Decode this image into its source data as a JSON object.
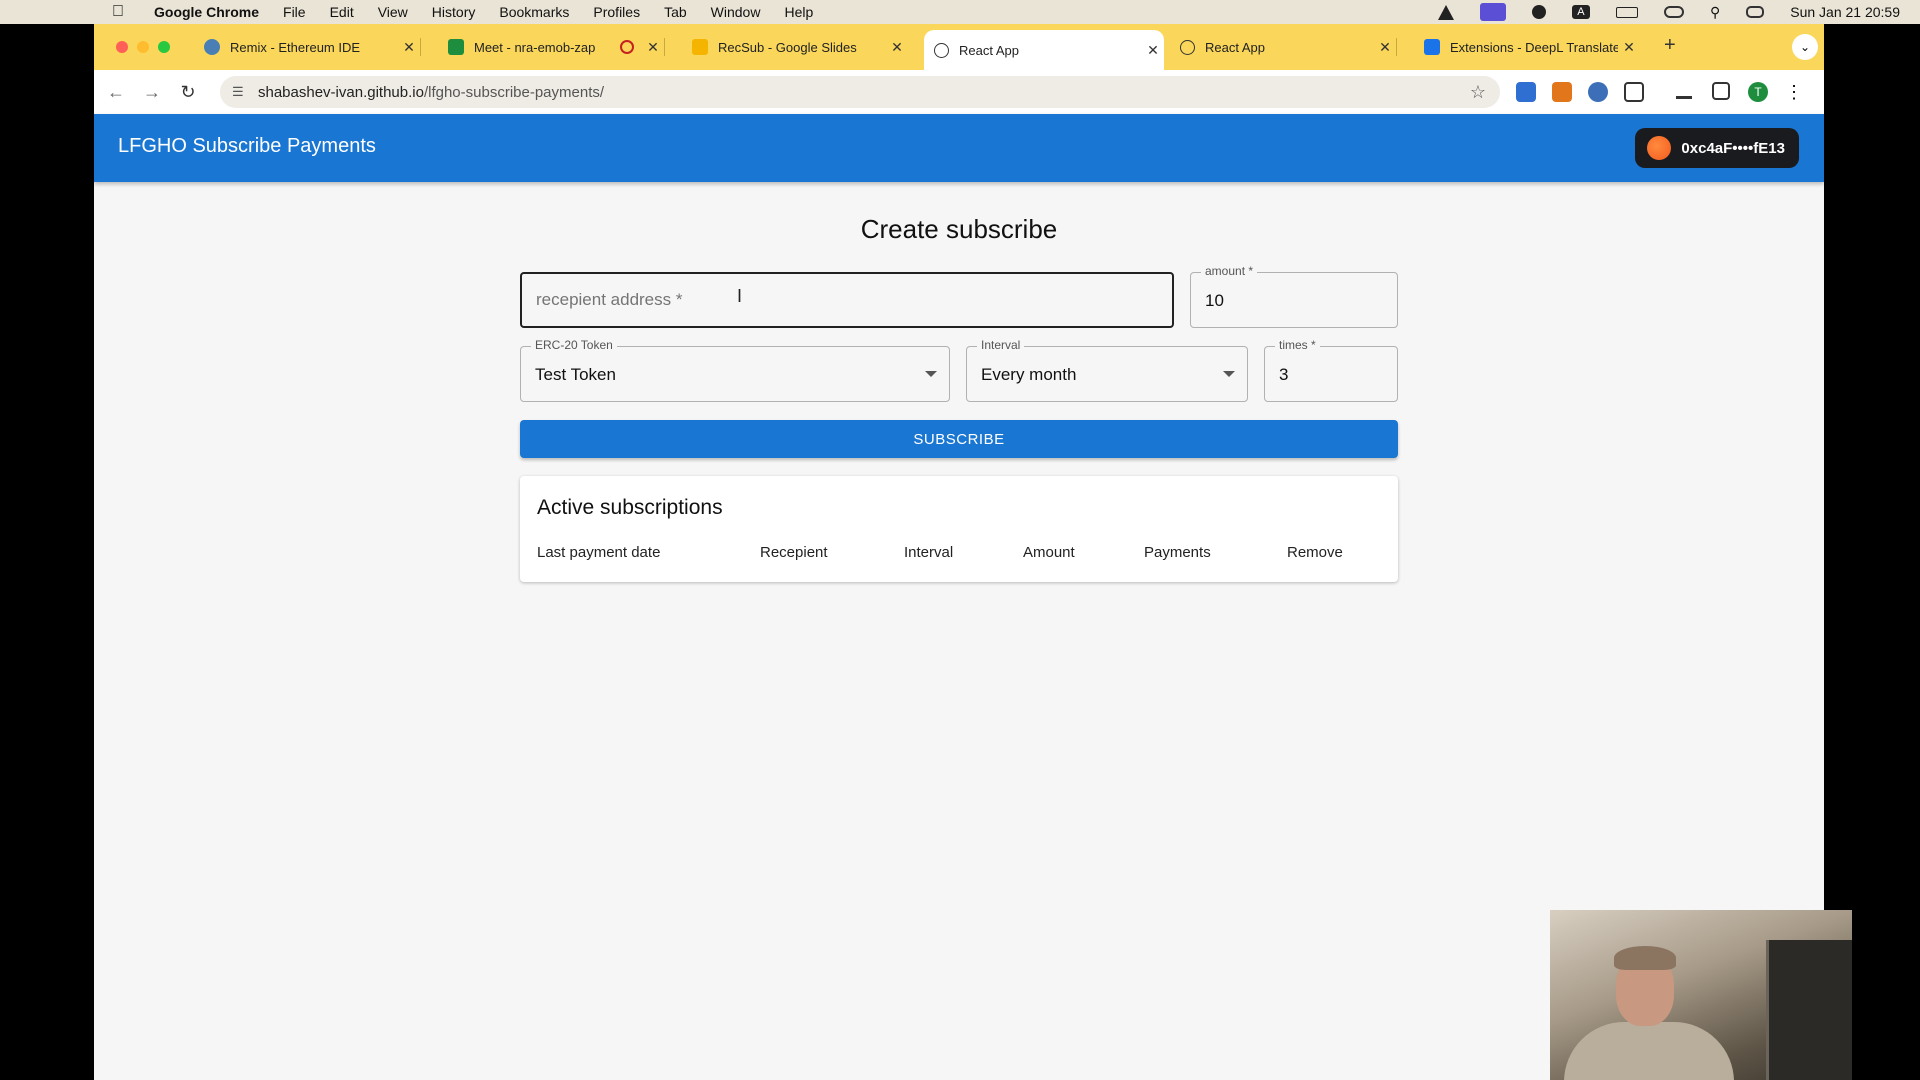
{
  "menubar": {
    "app": "Google Chrome",
    "items": [
      "File",
      "Edit",
      "View",
      "History",
      "Bookmarks",
      "Profiles",
      "Tab",
      "Window",
      "Help"
    ],
    "clock": "Sun Jan 21  20:59"
  },
  "tabs": [
    {
      "title": "Remix - Ethereum IDE",
      "favicon": "remix-icon",
      "color": "#4a7fb5"
    },
    {
      "title": "Meet - nra-emob-zap",
      "favicon": "meet-icon",
      "color": "#1e8e3e"
    },
    {
      "title": "RecSub - Google Slides",
      "favicon": "slides-icon",
      "color": "#f4b400"
    },
    {
      "title": "React App",
      "favicon": "react-icon",
      "color": "#333333"
    },
    {
      "title": "React App",
      "favicon": "react-icon",
      "color": "#333333"
    },
    {
      "title": "Extensions - DeepL Translate",
      "favicon": "puzzle-icon",
      "color": "#1a73e8"
    }
  ],
  "address_bar": {
    "host": "shabashev-ivan.github.io",
    "path": "/lfgho-subscribe-payments/"
  },
  "app": {
    "brand": "LFGHO Subscribe Payments",
    "wallet": "0xc4aF••••fE13",
    "colors": {
      "primary": "#1976d2",
      "wallet_bg": "#1a1b1f"
    }
  },
  "form": {
    "title": "Create subscribe",
    "recipient_placeholder": "recepient address *",
    "amount_label": "amount *",
    "amount_value": "10",
    "token_label": "ERC-20 Token",
    "token_value": "Test Token",
    "interval_label": "Interval",
    "interval_value": "Every month",
    "times_label": "times *",
    "times_value": "3",
    "submit_label": "SUBSCRIBE"
  },
  "subscriptions": {
    "title": "Active subscriptions",
    "columns": [
      "Last payment date",
      "Recepient",
      "Interval",
      "Amount",
      "Payments",
      "Remove"
    ]
  }
}
